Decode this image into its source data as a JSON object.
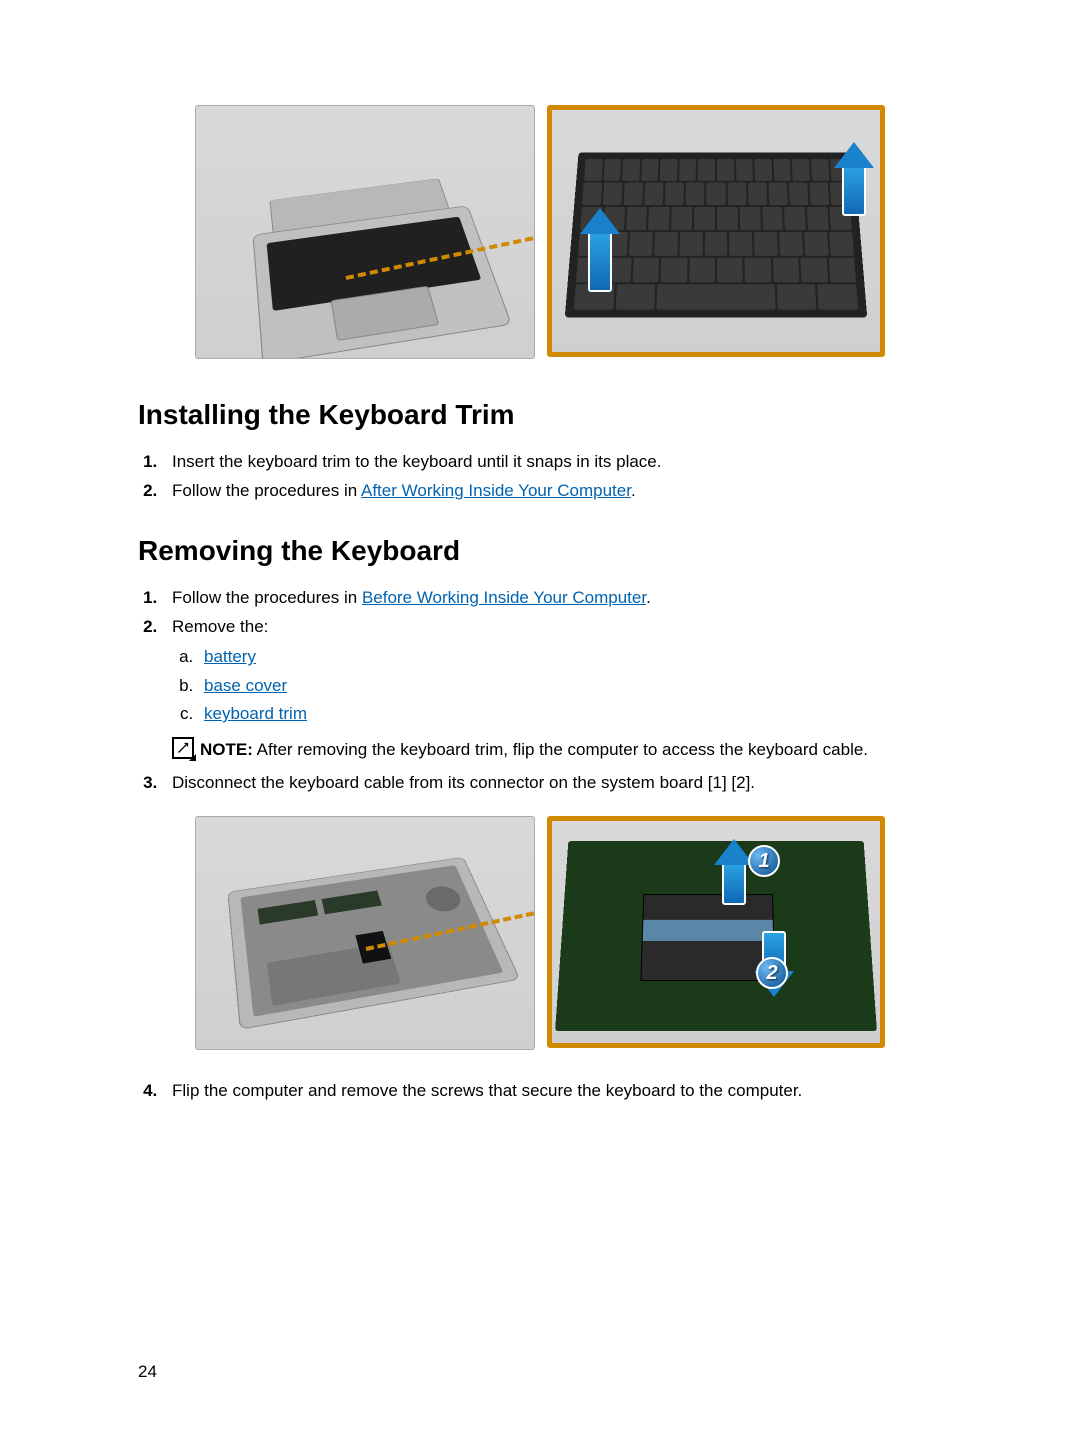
{
  "pageNumber": "24",
  "section1": {
    "heading": "Installing the Keyboard Trim",
    "steps": [
      {
        "text": "Insert the keyboard trim to the keyboard until it snaps in its place."
      },
      {
        "textBefore": "Follow the procedures in ",
        "link": "After Working Inside Your Computer",
        "textAfter": "."
      }
    ]
  },
  "section2": {
    "heading": "Removing the Keyboard",
    "step1": {
      "textBefore": "Follow the procedures in ",
      "link": "Before Working Inside Your Computer",
      "textAfter": "."
    },
    "step2": {
      "text": "Remove the:",
      "sub": [
        {
          "link": "battery"
        },
        {
          "link": "base cover"
        },
        {
          "link": "keyboard trim"
        }
      ],
      "noteLabel": "NOTE:",
      "noteText": " After removing the keyboard trim, flip the computer to access the keyboard cable."
    },
    "step3": {
      "text": "Disconnect the keyboard cable from its connector on the system board [1] [2]."
    },
    "step4": {
      "text": "Flip the computer and remove the screws that secure the keyboard to the computer."
    }
  },
  "callouts": {
    "badge1": "1",
    "badge2": "2"
  }
}
